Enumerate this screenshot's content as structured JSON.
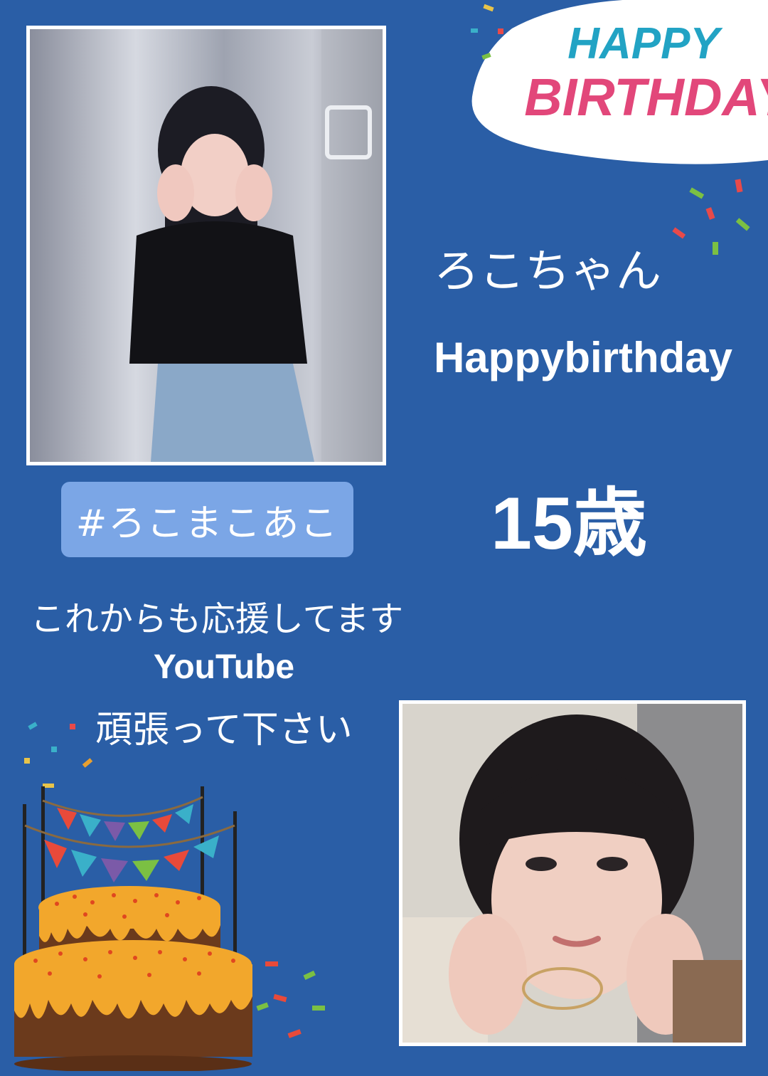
{
  "badge": {
    "line1": "HAPPY",
    "line2": "BIRTHDAY"
  },
  "name_line": "ろこちゃん",
  "greeting": "Happybirthday",
  "age": "15歳",
  "hashtag": "#ろこまこあこ",
  "message": {
    "line1": "これからも応援してます",
    "line2": "YouTube",
    "line3": "頑張って下さい"
  },
  "colors": {
    "background": "#2a5ea6",
    "hashtag_box": "#7ba6e6",
    "text": "#ffffff"
  }
}
